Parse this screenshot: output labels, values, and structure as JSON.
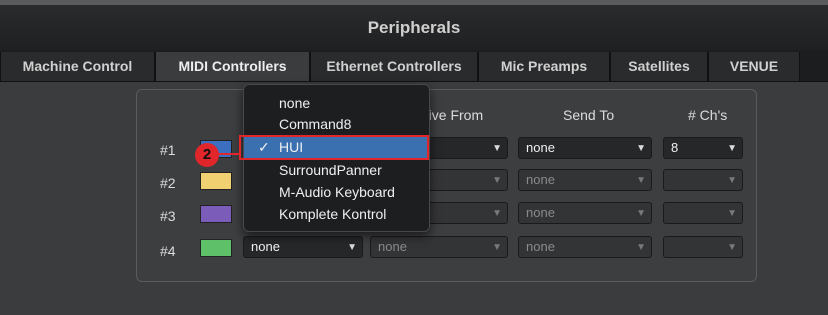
{
  "window": {
    "title": "Peripherals"
  },
  "tabs": [
    {
      "label": "Machine Control"
    },
    {
      "label": "MIDI Controllers"
    },
    {
      "label": "Ethernet Controllers"
    },
    {
      "label": "Mic Preamps"
    },
    {
      "label": "Satellites"
    },
    {
      "label": "VENUE"
    }
  ],
  "columns": {
    "receive_from": "Receive From",
    "send_to": "Send To",
    "channels": "# Ch's"
  },
  "rows": [
    {
      "label": "#1",
      "color": "#3c6fc0",
      "receive_from": "",
      "send_to": "none",
      "channels": "8"
    },
    {
      "label": "#2",
      "color": "#f0d070",
      "receive_from": "none",
      "send_to": "none",
      "channels": ""
    },
    {
      "label": "#3",
      "color": "#7b5cb8",
      "receive_from": "none",
      "send_to": "none",
      "channels": ""
    },
    {
      "label": "#4",
      "color": "#5fc06a",
      "type": "none",
      "receive_from": "none",
      "send_to": "none",
      "channels": ""
    }
  ],
  "dropdown": {
    "items": [
      {
        "label": "none"
      },
      {
        "label": "Command8"
      },
      {
        "label": "HUI",
        "checked": true
      },
      {
        "label": "SurroundPanner"
      },
      {
        "label": "M-Audio Keyboard"
      },
      {
        "label": "Komplete Kontrol"
      }
    ],
    "check_glyph": "✓"
  },
  "annotation": {
    "step": "2",
    "color": "#e0262b"
  }
}
